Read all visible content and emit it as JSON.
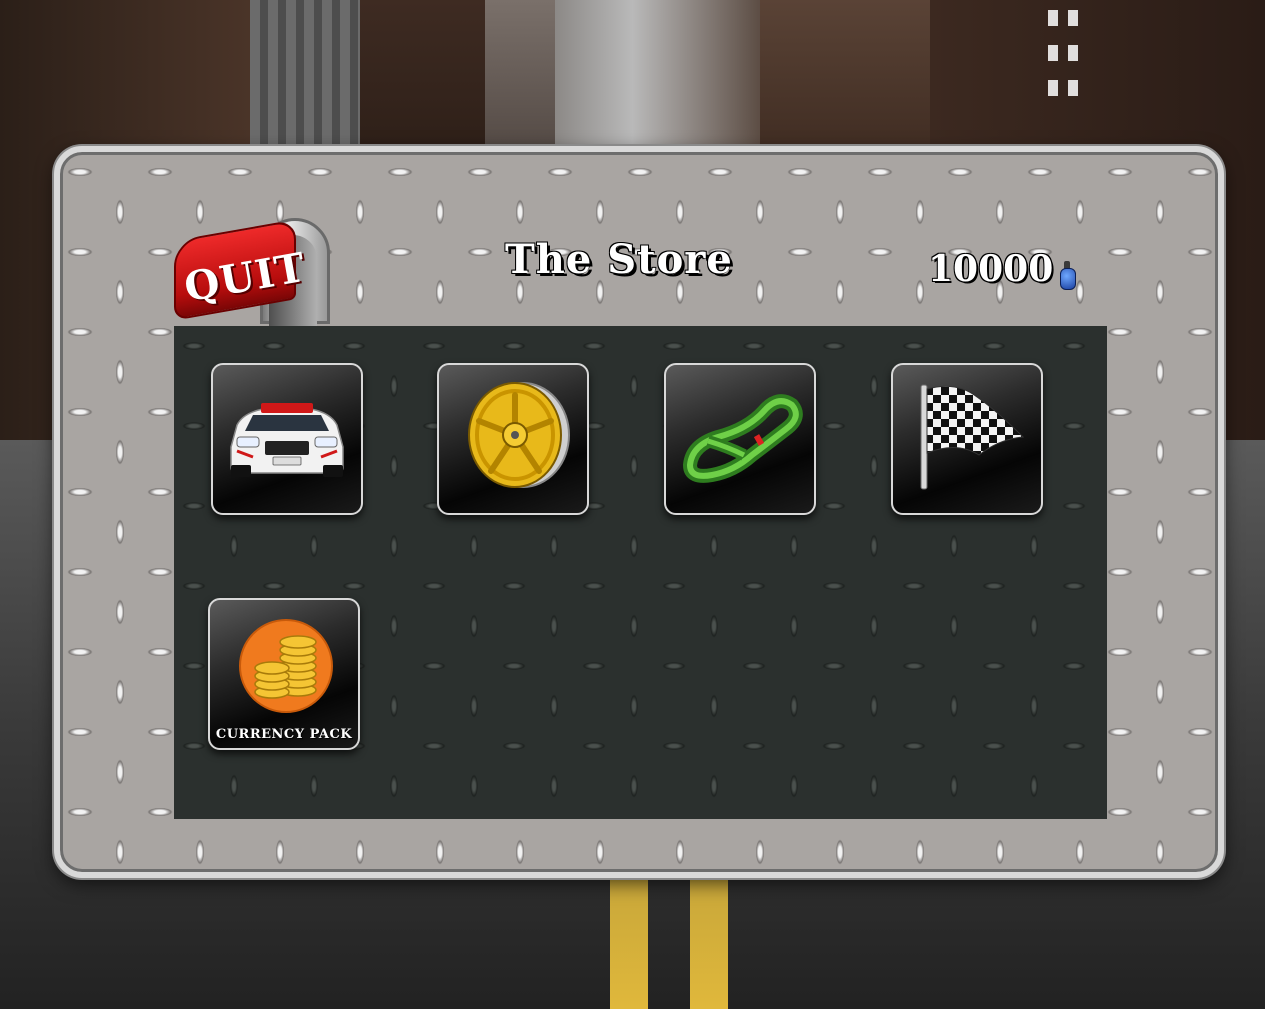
{
  "header": {
    "quit_label": "QUIT",
    "title": "The Store",
    "currency_value": "10000",
    "currency_icon": "potion-bottle-icon"
  },
  "store": {
    "items": [
      {
        "id": "cars",
        "icon": "race-car-icon",
        "label": ""
      },
      {
        "id": "wheels",
        "icon": "wheel-rim-icon",
        "label": ""
      },
      {
        "id": "tracks",
        "icon": "race-track-icon",
        "label": ""
      },
      {
        "id": "races",
        "icon": "checkered-flag-icon",
        "label": ""
      },
      {
        "id": "currency",
        "icon": "gold-coins-icon",
        "label": "CURRENCY PACK"
      }
    ]
  },
  "colors": {
    "quit_red": "#c81414",
    "panel_metal": "#a9a5a2",
    "store_bg": "#2b302e",
    "wheel_yellow": "#e8b91a",
    "track_green": "#3ca02a",
    "coins_orange": "#f07a1e"
  }
}
